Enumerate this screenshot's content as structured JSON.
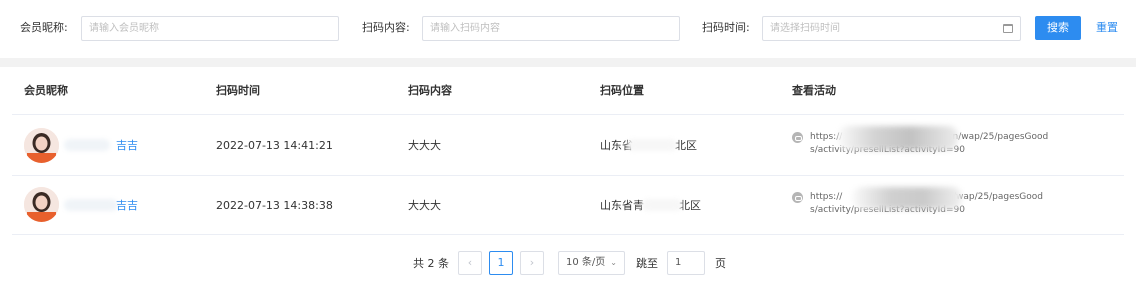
{
  "filters": {
    "nickname_label": "会员昵称:",
    "nickname_placeholder": "请输入会员昵称",
    "content_label": "扫码内容:",
    "content_placeholder": "请输入扫码内容",
    "time_label": "扫码时间:",
    "time_placeholder": "请选择扫码时间",
    "search_label": "搜索",
    "reset_label": "重置"
  },
  "table": {
    "headers": [
      "会员昵称",
      "扫码时间",
      "扫码内容",
      "扫码位置",
      "查看活动"
    ],
    "rows": [
      {
        "nickname": "吉吉",
        "time": "2022-07-13 14:41:21",
        "content": "大大大",
        "location": "山东省            北区",
        "url_line1": "https://                              pkg.cn/wap/25/pagesGood",
        "url_line2": "s/activity/presellList?activityId=90"
      },
      {
        "nickname": "吉吉",
        "time": "2022-07-13 14:38:38",
        "content": "大大大",
        "location": "山东省青          北区",
        "url_line1": "https://                         etpkg.cn/wap/25/pagesGood",
        "url_line2": "s/activity/presellList?activityId=90"
      }
    ]
  },
  "pagination": {
    "total": "共 2 条",
    "prev": "‹",
    "current_page": "1",
    "next": "›",
    "page_size": "10 条/页",
    "page_size_arrow": "⌄",
    "jump_label": "跳至",
    "jump_value": "1",
    "page_unit": "页"
  },
  "colors": {
    "accent": "#2d8cf0",
    "border": "#dcdfe6",
    "band": "#f2f2f2"
  }
}
